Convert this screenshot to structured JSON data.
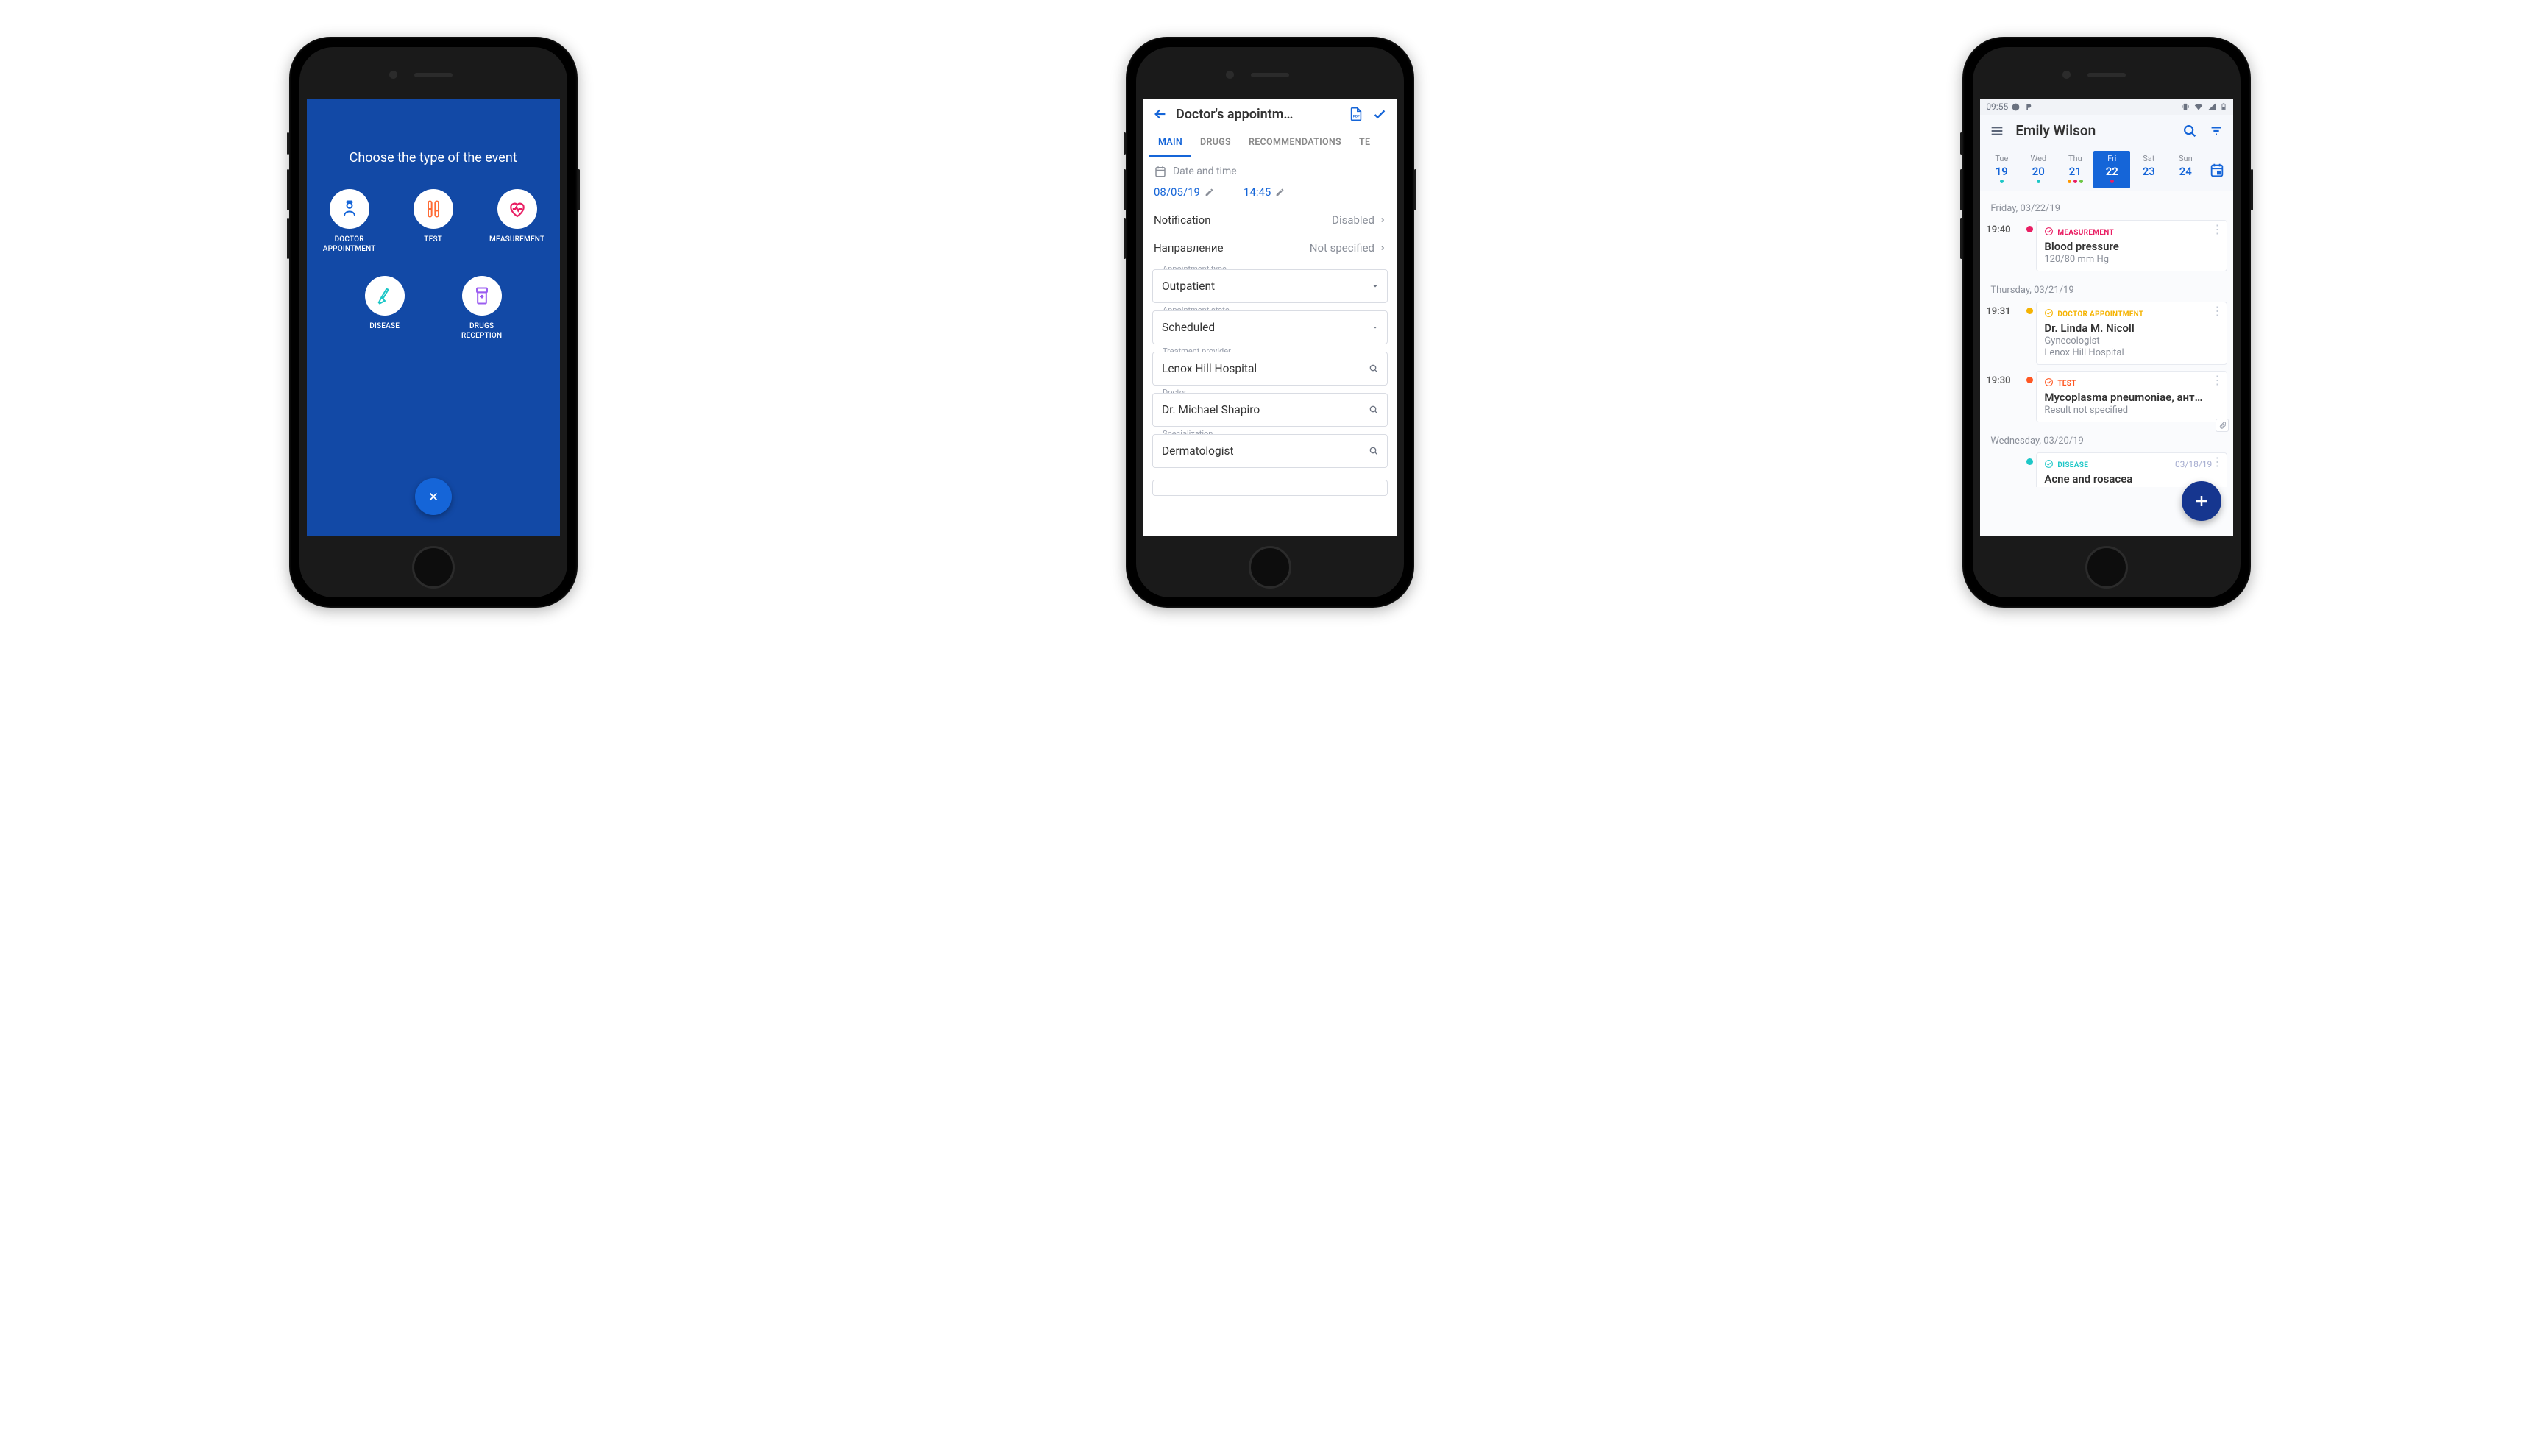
{
  "colors": {
    "blue": "#1565d8",
    "deepblue": "#1249a6",
    "pink": "#e91e63",
    "orange": "#ff9800",
    "teal": "#1dc7c7",
    "green": "#6cc644"
  },
  "phone1": {
    "title": "Choose the type of the event",
    "items": [
      {
        "key": "doctor",
        "label": "DOCTOR\nAPPOINTMENT"
      },
      {
        "key": "test",
        "label": "TEST"
      },
      {
        "key": "measurement",
        "label": "MEASUREMENT"
      },
      {
        "key": "disease",
        "label": "DISEASE"
      },
      {
        "key": "drugs",
        "label": "DRUGS\nRECEPTION"
      }
    ],
    "close_icon": "close-icon"
  },
  "phone2": {
    "title": "Doctor's appointm…",
    "tabs": [
      {
        "label": "MAIN",
        "active": true
      },
      {
        "label": "DRUGS"
      },
      {
        "label": "RECOMMENDATIONS"
      },
      {
        "label": "TE"
      }
    ],
    "date_section_label": "Date and time",
    "date": "08/05/19",
    "time": "14:45",
    "notification_key": "Notification",
    "notification_val": "Disabled",
    "direction_key": "Направление",
    "direction_val": "Not specified",
    "fields": [
      {
        "label": "Appointment type",
        "value": "Outpatient",
        "icon": "dropdown"
      },
      {
        "label": "Appointment state",
        "value": "Scheduled",
        "icon": "dropdown"
      },
      {
        "label": "Treatment provider",
        "value": "Lenox Hill Hospital",
        "icon": "search"
      },
      {
        "label": "Doctor",
        "value": "Dr. Michael Shapiro",
        "icon": "search"
      },
      {
        "label": "Specialization",
        "value": "Dermatologist",
        "icon": "search"
      }
    ]
  },
  "phone3": {
    "status_time": "09:55",
    "title": "Emily Wilson",
    "days": [
      {
        "dow": "Tue",
        "num": "19",
        "dots": [
          "#1dc7c7"
        ]
      },
      {
        "dow": "Wed",
        "num": "20",
        "dots": [
          "#1dc7c7"
        ]
      },
      {
        "dow": "Thu",
        "num": "21",
        "dots": [
          "#ff9800",
          "#e91e63",
          "#6cc644"
        ]
      },
      {
        "dow": "Fri",
        "num": "22",
        "dots": [
          "#e91e63"
        ],
        "selected": true
      },
      {
        "dow": "Sat",
        "num": "23",
        "dots": []
      },
      {
        "dow": "Sun",
        "num": "24",
        "dots": []
      }
    ],
    "groups": [
      {
        "header": "Friday, 03/22/19",
        "rows": [
          {
            "time": "19:40",
            "bullet": "#e91e63",
            "type": "MEASUREMENT",
            "typecolor": "#e91e63",
            "title": "Blood pressure",
            "sub": "120/80 mm Hg"
          }
        ]
      },
      {
        "header": "Thursday, 03/21/19",
        "rows": [
          {
            "time": "19:31",
            "bullet": "#f5b301",
            "type": "DOCTOR APPOINTMENT",
            "typecolor": "#f5b301",
            "title": "Dr. Linda M. Nicoll",
            "sub": "Gynecologist",
            "sub2": "Lenox Hill Hospital"
          },
          {
            "time": "19:30",
            "bullet": "#ff5722",
            "type": "TEST",
            "typecolor": "#ff5722",
            "title": "Mycoplasma pneumoniae, ант…",
            "sub": "Result not specified",
            "clip": true
          }
        ]
      },
      {
        "header": "Wednesday, 03/20/19",
        "rows": [
          {
            "time": "",
            "bullet": "#1dc7c7",
            "type": "DISEASE",
            "typecolor": "#1dc7c7",
            "title": "Acne and rosacea",
            "date": "03/18/19",
            "partial": true
          }
        ]
      }
    ]
  }
}
